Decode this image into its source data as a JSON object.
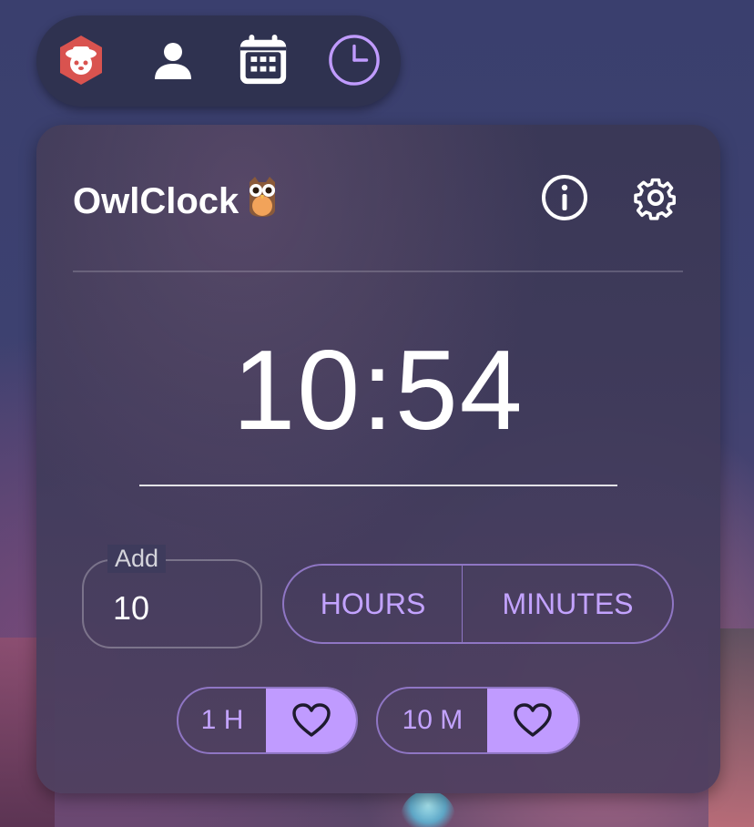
{
  "app": {
    "title": "OwlClock"
  },
  "toolbar": {
    "items": [
      {
        "name": "app-logo",
        "active": false
      },
      {
        "name": "profile",
        "active": false
      },
      {
        "name": "calendar",
        "active": false
      },
      {
        "name": "clock",
        "active": true
      }
    ]
  },
  "clock": {
    "time": "10:54"
  },
  "add": {
    "label": "Add",
    "value": "10"
  },
  "units": {
    "hours_label": "HOURS",
    "minutes_label": "MINUTES"
  },
  "presets": [
    {
      "label": "1 H"
    },
    {
      "label": "10 M"
    }
  ],
  "colors": {
    "accent": "#c09bff",
    "accent_text": "#c3a3ff",
    "card_bg": "#3e3b5c",
    "toolbar_bg": "#2f3250",
    "logo_red": "#d9534f"
  }
}
